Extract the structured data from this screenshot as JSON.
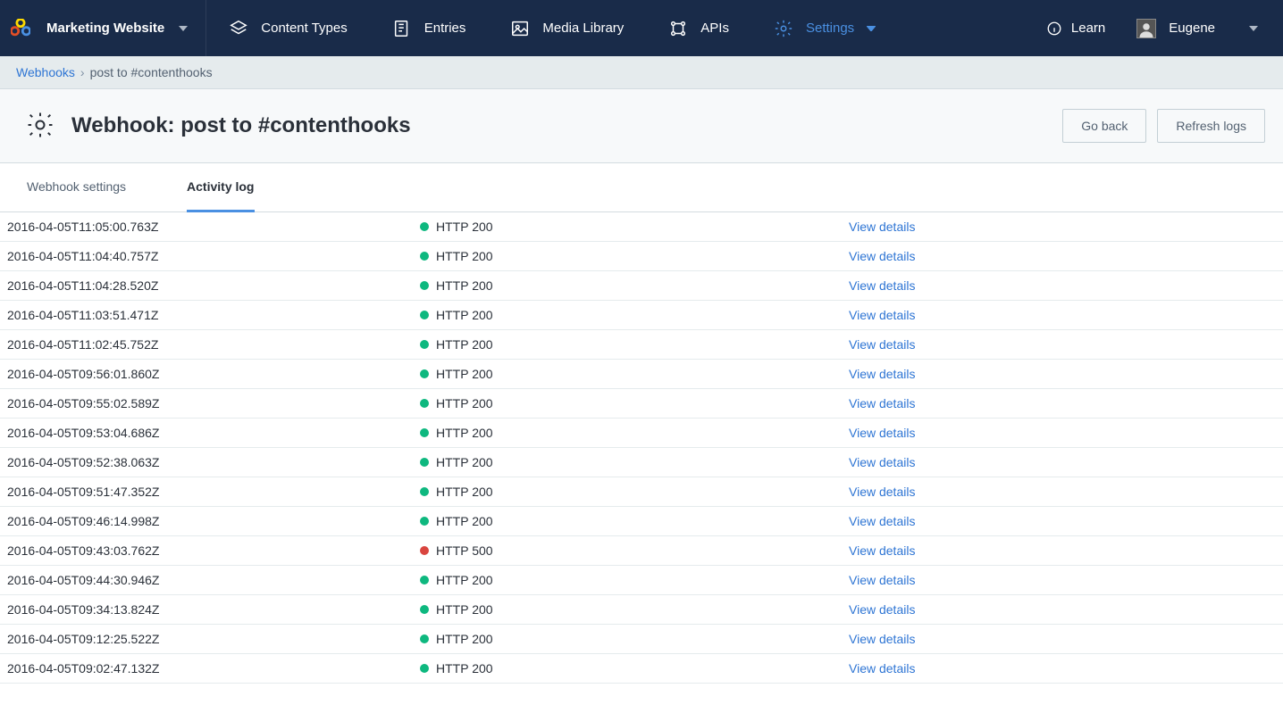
{
  "topbar": {
    "space_name": "Marketing Website",
    "nav": [
      {
        "label": "Content Types"
      },
      {
        "label": "Entries"
      },
      {
        "label": "Media Library"
      },
      {
        "label": "APIs"
      },
      {
        "label": "Settings",
        "active": true,
        "dropdown": true
      }
    ],
    "learn_label": "Learn",
    "user_name": "Eugene"
  },
  "breadcrumb": {
    "root": "Webhooks",
    "current": "post to #contenthooks"
  },
  "page": {
    "title": "Webhook: post to #contenthooks",
    "go_back": "Go back",
    "refresh": "Refresh logs"
  },
  "tabs": [
    {
      "label": "Webhook settings",
      "active": false
    },
    {
      "label": "Activity log",
      "active": true
    }
  ],
  "view_details_label": "View details",
  "logs": [
    {
      "ts": "2016-04-05T11:05:00.763Z",
      "status": "HTTP 200",
      "ok": true
    },
    {
      "ts": "2016-04-05T11:04:40.757Z",
      "status": "HTTP 200",
      "ok": true
    },
    {
      "ts": "2016-04-05T11:04:28.520Z",
      "status": "HTTP 200",
      "ok": true
    },
    {
      "ts": "2016-04-05T11:03:51.471Z",
      "status": "HTTP 200",
      "ok": true
    },
    {
      "ts": "2016-04-05T11:02:45.752Z",
      "status": "HTTP 200",
      "ok": true
    },
    {
      "ts": "2016-04-05T09:56:01.860Z",
      "status": "HTTP 200",
      "ok": true
    },
    {
      "ts": "2016-04-05T09:55:02.589Z",
      "status": "HTTP 200",
      "ok": true
    },
    {
      "ts": "2016-04-05T09:53:04.686Z",
      "status": "HTTP 200",
      "ok": true
    },
    {
      "ts": "2016-04-05T09:52:38.063Z",
      "status": "HTTP 200",
      "ok": true
    },
    {
      "ts": "2016-04-05T09:51:47.352Z",
      "status": "HTTP 200",
      "ok": true
    },
    {
      "ts": "2016-04-05T09:46:14.998Z",
      "status": "HTTP 200",
      "ok": true
    },
    {
      "ts": "2016-04-05T09:43:03.762Z",
      "status": "HTTP 500",
      "ok": false
    },
    {
      "ts": "2016-04-05T09:44:30.946Z",
      "status": "HTTP 200",
      "ok": true
    },
    {
      "ts": "2016-04-05T09:34:13.824Z",
      "status": "HTTP 200",
      "ok": true
    },
    {
      "ts": "2016-04-05T09:12:25.522Z",
      "status": "HTTP 200",
      "ok": true
    },
    {
      "ts": "2016-04-05T09:02:47.132Z",
      "status": "HTTP 200",
      "ok": true
    }
  ]
}
